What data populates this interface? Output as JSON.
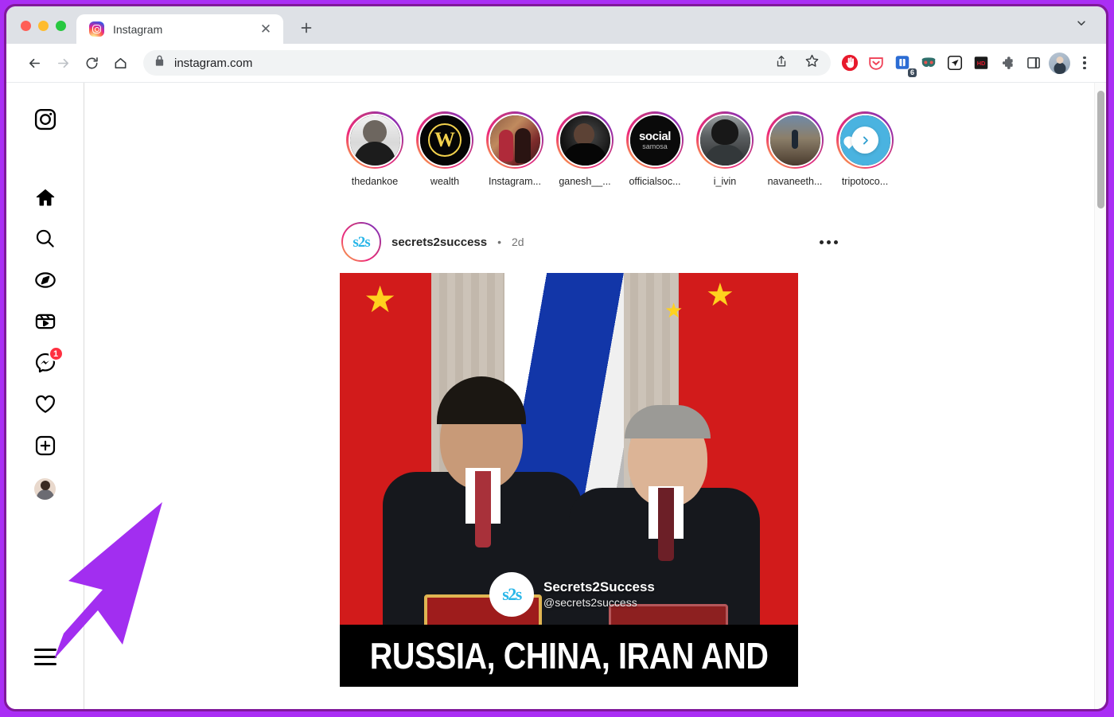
{
  "browser": {
    "tab": {
      "title": "Instagram",
      "favicon_icon": "instagram-icon",
      "close_icon": "close-icon"
    },
    "new_tab_icon": "plus-icon",
    "tab_search_icon": "chevron-down-icon",
    "window_controls": [
      "close",
      "minimize",
      "maximize"
    ],
    "nav": {
      "back_icon": "arrow-left-icon",
      "forward_icon": "arrow-right-icon",
      "reload_icon": "reload-icon",
      "home_icon": "home-icon"
    },
    "omnibox": {
      "lock_icon": "lock-icon",
      "url": "instagram.com",
      "share_icon": "share-icon",
      "bookmark_icon": "star-icon"
    },
    "extensions": [
      {
        "name": "adblock-extension-icon",
        "color": "#e8192c"
      },
      {
        "name": "pocket-extension-icon",
        "color": "#ef4056"
      },
      {
        "name": "notes-extension-icon",
        "color": "#2b6cd4",
        "badge": "6"
      },
      {
        "name": "mask-extension-icon",
        "color": "#2f6f6b"
      },
      {
        "name": "send-extension-icon",
        "color": "#1b1b1b"
      },
      {
        "name": "hd-extension-icon",
        "color": "#1a1a1a",
        "label": "HD"
      },
      {
        "name": "puzzle-extensions-icon",
        "color": "#5f6368"
      },
      {
        "name": "side-panel-icon",
        "color": "#3c4043"
      }
    ],
    "profile_icon": "profile-avatar",
    "menu_icon": "kebab-menu-icon"
  },
  "instagram": {
    "sidebar": [
      {
        "name": "instagram-logo",
        "icon": "instagram-wordmark-icon"
      },
      {
        "name": "home",
        "icon": "home-icon"
      },
      {
        "name": "search",
        "icon": "search-icon"
      },
      {
        "name": "explore",
        "icon": "compass-icon"
      },
      {
        "name": "reels",
        "icon": "reels-icon"
      },
      {
        "name": "messages",
        "icon": "messenger-icon",
        "badge": "1"
      },
      {
        "name": "notifications",
        "icon": "heart-icon"
      },
      {
        "name": "create",
        "icon": "plus-square-icon"
      },
      {
        "name": "profile",
        "icon": "avatar"
      },
      {
        "name": "more",
        "icon": "hamburger-icon"
      }
    ],
    "stories": [
      {
        "username": "thedankoe",
        "art": "a-dankoe"
      },
      {
        "username": "wealth",
        "art": "a-wealth"
      },
      {
        "username": "Instagram...",
        "art": "a-insta"
      },
      {
        "username": "ganesh__...",
        "art": "a-ganesh"
      },
      {
        "username": "officialsoc...",
        "art": "a-social"
      },
      {
        "username": "i_ivin",
        "art": "a-ivin"
      },
      {
        "username": "navaneeth...",
        "art": "a-nava"
      },
      {
        "username": "tripotoco...",
        "art": "a-tripo"
      }
    ],
    "story_next_icon": "chevron-right-icon",
    "post": {
      "username": "secrets2success",
      "separator": "•",
      "timestamp": "2d",
      "more_icon": "more-options-icon",
      "avatar_text": "s2s",
      "watermark": {
        "logo_text": "s2s",
        "title": "Secrets2Success",
        "handle": "@secrets2success"
      },
      "headline": "RUSSIA, CHINA, IRAN AND"
    }
  },
  "annotation": {
    "arrow_color": "#a22ef0",
    "frame_color": "#aa2ef5"
  }
}
